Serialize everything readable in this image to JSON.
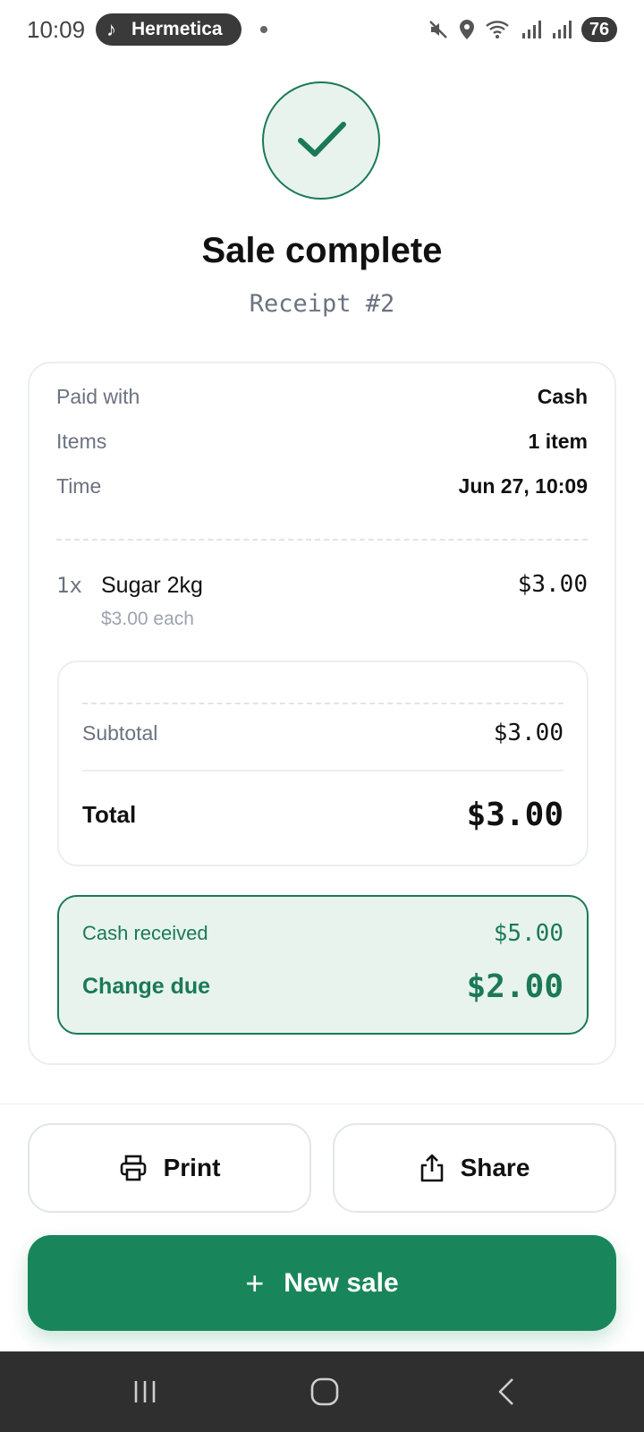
{
  "status_bar": {
    "time": "10:09",
    "media_app": "Hermetica",
    "battery": "76",
    "icons": [
      "muted-icon",
      "location-icon",
      "wifi-icon",
      "signal-icon",
      "signal-icon"
    ]
  },
  "hero": {
    "icon": "check-icon",
    "title": "Sale complete",
    "receipt": "Receipt #2"
  },
  "summary": {
    "paid_with_label": "Paid with",
    "paid_with_value": "Cash",
    "items_label": "Items",
    "items_value": "1 item",
    "time_label": "Time",
    "time_value": "Jun 27, 10:09"
  },
  "line_items": [
    {
      "qty": "1x",
      "name": "Sugar 2kg",
      "unit": "$3.00 each",
      "price": "$3.00"
    }
  ],
  "totals": {
    "subtotal_label": "Subtotal",
    "subtotal_value": "$3.00",
    "total_label": "Total",
    "total_value": "$3.00"
  },
  "cash": {
    "received_label": "Cash received",
    "received_value": "$5.00",
    "change_label": "Change due",
    "change_value": "$2.00"
  },
  "actions": {
    "print_label": "Print",
    "share_label": "Share",
    "new_sale_label": "New sale",
    "new_sale_icon": "+"
  },
  "colors": {
    "accent": "#18865a",
    "accent_dark": "#1a7a55",
    "accent_bg": "#e8f3ee",
    "muted_text": "#6b7280"
  }
}
